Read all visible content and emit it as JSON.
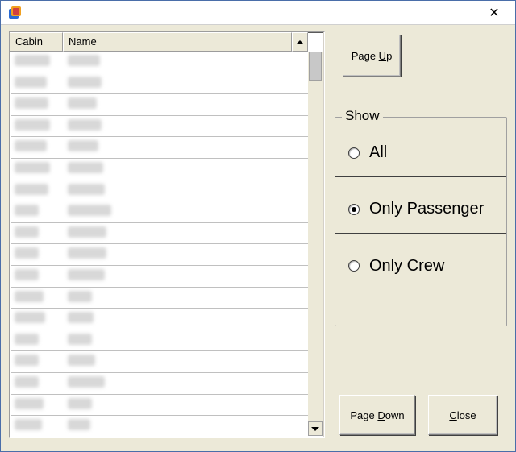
{
  "titlebar": {
    "close_glyph": "✕"
  },
  "table": {
    "headers": {
      "cabin": "Cabin",
      "name": "Name"
    },
    "rows": [
      {
        "cabin_w": 44,
        "name_w": 40
      },
      {
        "cabin_w": 40,
        "name_w": 42
      },
      {
        "cabin_w": 42,
        "name_w": 36
      },
      {
        "cabin_w": 44,
        "name_w": 42
      },
      {
        "cabin_w": 40,
        "name_w": 38
      },
      {
        "cabin_w": 44,
        "name_w": 44
      },
      {
        "cabin_w": 42,
        "name_w": 46
      },
      {
        "cabin_w": 30,
        "name_w": 54
      },
      {
        "cabin_w": 30,
        "name_w": 48
      },
      {
        "cabin_w": 30,
        "name_w": 48
      },
      {
        "cabin_w": 30,
        "name_w": 46
      },
      {
        "cabin_w": 36,
        "name_w": 30
      },
      {
        "cabin_w": 38,
        "name_w": 32
      },
      {
        "cabin_w": 30,
        "name_w": 30
      },
      {
        "cabin_w": 30,
        "name_w": 34
      },
      {
        "cabin_w": 30,
        "name_w": 46
      },
      {
        "cabin_w": 36,
        "name_w": 30
      },
      {
        "cabin_w": 34,
        "name_w": 28
      }
    ]
  },
  "buttons": {
    "page_up_pre": "Page ",
    "page_up_ul": "U",
    "page_up_post": "p",
    "page_down_pre": "Page ",
    "page_down_ul": "D",
    "page_down_post": "own",
    "close_pre": "",
    "close_ul": "C",
    "close_post": "lose"
  },
  "filter": {
    "legend": "Show",
    "options": [
      {
        "label": "All",
        "selected": false
      },
      {
        "label": "Only Passenger",
        "selected": true
      },
      {
        "label": "Only Crew",
        "selected": false
      }
    ]
  }
}
